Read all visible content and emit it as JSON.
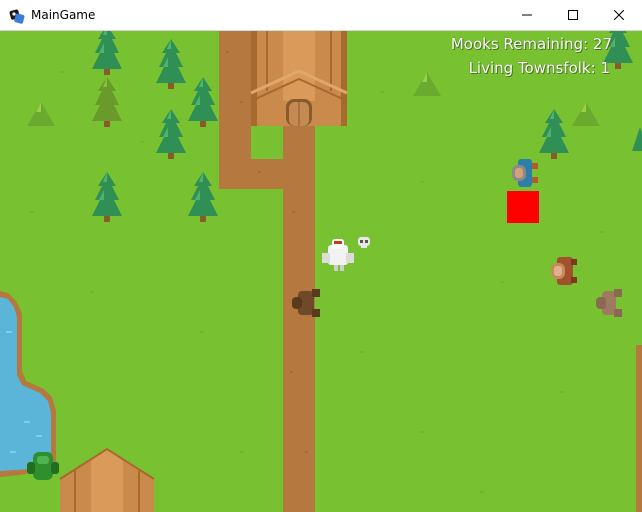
{
  "window": {
    "title": "MainGame"
  },
  "hud": {
    "mooks_label": "Mooks Remaining: 27",
    "townsfolk_label": "Living Townsfolk: 1"
  },
  "colors": {
    "grass": "#78c232",
    "path": "#b5783e",
    "water": "#5bb5d8",
    "building": "#c98a4c",
    "tree": "#2f8f55",
    "selection": "#ff0000"
  }
}
